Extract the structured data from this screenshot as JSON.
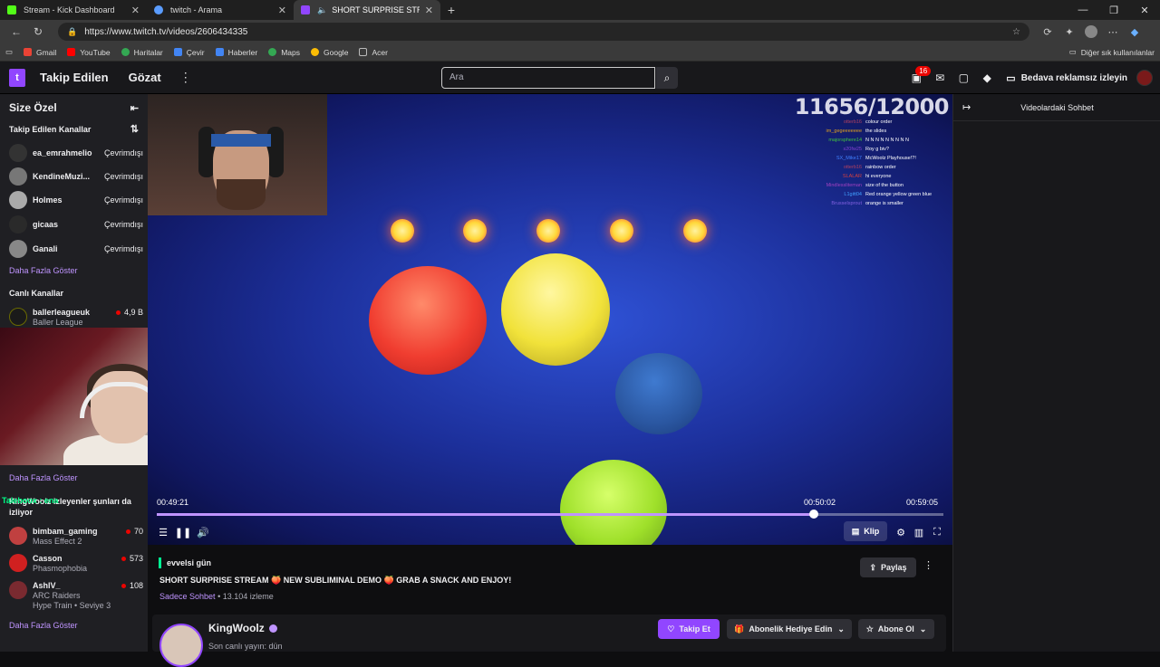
{
  "browser": {
    "tabs": [
      {
        "title": "Stream - Kick Dashboard",
        "color": "#53fc18"
      },
      {
        "title": "twitch - Arama",
        "color": "#5a9cff"
      },
      {
        "title": "SHORT SURPRISE STREAM",
        "color": "#9146ff"
      }
    ],
    "url": "https://www.twitch.tv/videos/2606434335",
    "bookmarks": [
      "Gmail",
      "YouTube",
      "Haritalar",
      "Çevir",
      "Haberler",
      "Maps",
      "Google",
      "Acer"
    ],
    "bookmarks_other": "Diğer sık kullanılanlar"
  },
  "twitch_top": {
    "nav_following": "Takip Edilen",
    "nav_browse": "Gözat",
    "search_placeholder": "Ara",
    "notif_count": "16",
    "adfree_label": "Bedava reklamsız izleyin"
  },
  "sidebar": {
    "title": "Size Özel",
    "followed_title": "Takip Edilen Kanallar",
    "followed": [
      {
        "name": "ea_emrahmelio",
        "status": "Çevrimdışı"
      },
      {
        "name": "KendineMuzi...",
        "status": "Çevrimdışı"
      },
      {
        "name": "Holmes",
        "status": "Çevrimdışı"
      },
      {
        "name": "gicaas",
        "status": "Çevrimdışı"
      },
      {
        "name": "Ganali",
        "status": "Çevrimdışı"
      }
    ],
    "show_more": "Daha Fazla Göster",
    "live_title": "Canlı Kanallar",
    "live_first": {
      "name": "ballerleagueuk",
      "game": "Baller League",
      "viewers": "4,9 B"
    },
    "show_more_2": "Daha Fazla Göster",
    "rec_title": "KingWoolz izleyenler şunları da izliyor",
    "rec_overlay": "Taleboox : ena",
    "recs": [
      {
        "name": "bimbam_gaming",
        "game": "Mass Effect 2",
        "viewers": "70",
        "color": "#c04040"
      },
      {
        "name": "Casson",
        "game": "Phasmophobia",
        "viewers": "573",
        "color": "#d02020"
      },
      {
        "name": "AshlV_",
        "game": "ARC Raiders",
        "viewers": "108",
        "color": "#7a2a30",
        "extra": "Hype Train • Seviye 3"
      }
    ],
    "show_more_3": "Daha Fazla Göster"
  },
  "player": {
    "score": "11656/12000",
    "overlay_chat": [
      {
        "user": "otterb16",
        "msg": "colour order",
        "color": "#b04060"
      },
      {
        "user": "im_gegeeeeeee",
        "msg": "the slides",
        "color": "#e0a020"
      },
      {
        "user": "majorsphere14",
        "msg": "N N N N N N N N N",
        "color": "#40c040"
      },
      {
        "user": "s20fw25",
        "msg": "Roy g biv?",
        "color": "#8040d0"
      },
      {
        "user": "SX_Mike17",
        "msg": "McWoolz Playhouse!?!",
        "color": "#4080ff"
      },
      {
        "user": "otterb16",
        "msg": "rainbow order",
        "color": "#b04060"
      },
      {
        "user": "SLALAR",
        "msg": "hi everyone",
        "color": "#d04040"
      },
      {
        "user": "Mindlessliteman",
        "msg": "size of the button",
        "color": "#a040c0"
      },
      {
        "user": "L1gitt04",
        "msg": "Red orange yellow green blue",
        "color": "#40a0ff"
      },
      {
        "user": "Brusselsprout",
        "msg": "orange is smaller",
        "color": "#8060e0"
      }
    ],
    "time_current": "00:49:21",
    "time_hover": "00:50:02",
    "time_total": "00:59:05",
    "progress": 0.835,
    "clip_label": "Klip"
  },
  "video_info": {
    "category": "evvelsi gün",
    "title": "SHORT SURPRISE STREAM 🍑 NEW SUBLIMINAL DEMO 🍑 GRAB A SNACK AND ENJOY!",
    "meta_link": "Sadece Sohbet",
    "meta_views": " • 13.104 izleme",
    "share_label": "Paylaş",
    "channel_name": "KingWoolz",
    "channel_sub": "Son canlı yayın: dün",
    "follow_label": "Takip Et",
    "gift_label": "Abonelik Hediye Edin",
    "subscribe_label": "Abone Ol"
  },
  "chat_panel": {
    "title": "Videolardaki Sohbet"
  }
}
